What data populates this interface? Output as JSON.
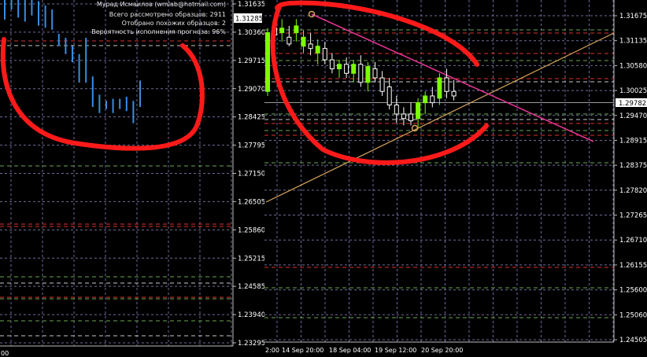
{
  "colors": {
    "background": "#000000",
    "axis_text": "#ffffff",
    "grid": "#6d6d9a",
    "bull_candle": "#7cfc00",
    "bear_candle": "#ffffff",
    "left_series": "#3a8de0",
    "resistance_line": "#e0338f",
    "support_line": "#d4a35a",
    "annotation": "#ff1a1a",
    "level_red": "#e03030",
    "level_green": "#6aa84f",
    "level_white": "#c8c8c8",
    "current_price_line": "#9a9a9a"
  },
  "left_panel": {
    "info_lines": [
      "Мурад Исмаилов (wmlab@hotmail.com)",
      "Всего рассмотрено образцов: 2911",
      "Отобрано похожих образцов: 2",
      "Вероятность исполнения прогноза: 96%"
    ],
    "price_ticks": [
      "1.31635",
      "1.30360",
      "1.29715",
      "1.29070",
      "1.28425",
      "1.27795",
      "1.27150",
      "1.26505",
      "1.25860",
      "1.25215",
      "1.24585",
      "1.23940",
      "1.23295"
    ],
    "current_price": "1.31285",
    "time_label": "00"
  },
  "chart_data": [
    {
      "type": "bar",
      "title": "",
      "note": "Left panel: blue vertical price bars (projected pattern)",
      "ylim": [
        1.231,
        1.318
      ],
      "bars": [
        {
          "high": 1.3195,
          "low": 1.3125
        },
        {
          "high": 1.319,
          "low": 1.315
        },
        {
          "high": 1.3185,
          "low": 1.313
        },
        {
          "high": 1.318,
          "low": 1.312
        },
        {
          "high": 1.3175,
          "low": 1.3135
        },
        {
          "high": 1.317,
          "low": 1.311
        },
        {
          "high": 1.316,
          "low": 1.3105
        },
        {
          "high": 1.315,
          "low": 1.31
        },
        {
          "high": 1.309,
          "low": 1.306
        },
        {
          "high": 1.308,
          "low": 1.304
        },
        {
          "high": 1.306,
          "low": 1.302
        },
        {
          "high": 1.304,
          "low": 1.297
        },
        {
          "high": 1.308,
          "low": 1.297
        },
        {
          "high": 1.2985,
          "low": 1.291
        },
        {
          "high": 1.294,
          "low": 1.2895
        },
        {
          "high": 1.2925,
          "low": 1.2905
        },
        {
          "high": 1.293,
          "low": 1.2895
        },
        {
          "high": 1.293,
          "low": 1.2905
        },
        {
          "high": 1.2935,
          "low": 1.29
        },
        {
          "high": 1.2925,
          "low": 1.287
        },
        {
          "high": 1.2975,
          "low": 1.291
        }
      ]
    },
    {
      "type": "candlestick",
      "title": "",
      "ylim": [
        1.244,
        1.32
      ],
      "price_ticks": [
        "1.31675",
        "1.31135",
        "1.30580",
        "1.30025",
        "1.29470",
        "1.28915",
        "1.28375",
        "1.27820",
        "1.27265",
        "1.26710",
        "1.26155",
        "1.25600",
        "1.25060",
        "1.24505"
      ],
      "current_price": "1.29782",
      "time_labels": [
        "2:00",
        "14 Sep 20:00",
        "18 Sep 04:00",
        "19 Sep 12:00",
        "20 Sep 20:00"
      ],
      "candles": [
        {
          "o": 1.3,
          "h": 1.314,
          "l": 1.299,
          "c": 1.313
        },
        {
          "o": 1.314,
          "h": 1.3165,
          "l": 1.3115,
          "c": 1.3125
        },
        {
          "o": 1.313,
          "h": 1.316,
          "l": 1.311,
          "c": 1.314
        },
        {
          "o": 1.312,
          "h": 1.3145,
          "l": 1.31,
          "c": 1.3105
        },
        {
          "o": 1.313,
          "h": 1.316,
          "l": 1.311,
          "c": 1.3145
        },
        {
          "o": 1.31,
          "h": 1.3135,
          "l": 1.3085,
          "c": 1.312
        },
        {
          "o": 1.3105,
          "h": 1.313,
          "l": 1.308,
          "c": 1.3095
        },
        {
          "o": 1.3085,
          "h": 1.3115,
          "l": 1.306,
          "c": 1.31
        },
        {
          "o": 1.3095,
          "h": 1.311,
          "l": 1.306,
          "c": 1.307
        },
        {
          "o": 1.307,
          "h": 1.3085,
          "l": 1.304,
          "c": 1.305
        },
        {
          "o": 1.305,
          "h": 1.307,
          "l": 1.303,
          "c": 1.306
        },
        {
          "o": 1.306,
          "h": 1.3075,
          "l": 1.303,
          "c": 1.304
        },
        {
          "o": 1.304,
          "h": 1.307,
          "l": 1.302,
          "c": 1.306
        },
        {
          "o": 1.306,
          "h": 1.308,
          "l": 1.301,
          "c": 1.302
        },
        {
          "o": 1.302,
          "h": 1.3065,
          "l": 1.3,
          "c": 1.3055
        },
        {
          "o": 1.305,
          "h": 1.3065,
          "l": 1.302,
          "c": 1.303
        },
        {
          "o": 1.303,
          "h": 1.3045,
          "l": 1.299,
          "c": 1.3
        },
        {
          "o": 1.301,
          "h": 1.303,
          "l": 1.296,
          "c": 1.297
        },
        {
          "o": 1.297,
          "h": 1.299,
          "l": 1.293,
          "c": 1.295
        },
        {
          "o": 1.295,
          "h": 1.2965,
          "l": 1.2925,
          "c": 1.294
        },
        {
          "o": 1.295,
          "h": 1.2975,
          "l": 1.2925,
          "c": 1.2935
        },
        {
          "o": 1.294,
          "h": 1.2985,
          "l": 1.292,
          "c": 1.2975
        },
        {
          "o": 1.2975,
          "h": 1.3,
          "l": 1.295,
          "c": 1.299
        },
        {
          "o": 1.299,
          "h": 1.301,
          "l": 1.2965,
          "c": 1.2975
        },
        {
          "o": 1.2985,
          "h": 1.304,
          "l": 1.297,
          "c": 1.303
        },
        {
          "o": 1.303,
          "h": 1.305,
          "l": 1.2985,
          "c": 1.3
        },
        {
          "o": 1.3,
          "h": 1.3025,
          "l": 1.298,
          "c": 1.299
        }
      ]
    }
  ]
}
